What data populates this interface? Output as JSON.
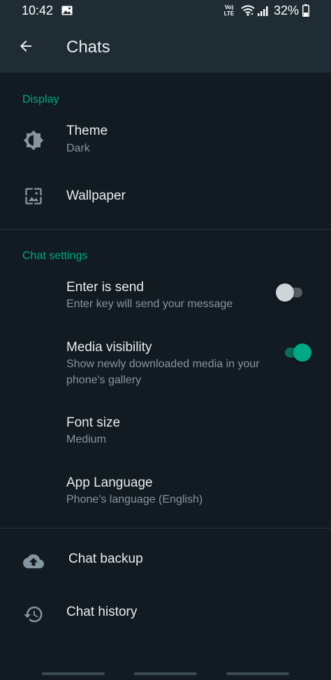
{
  "status_bar": {
    "time": "10:42",
    "network_label": "Vo) LTE",
    "battery_percent": "32%",
    "battery_level": 0.32
  },
  "app_bar": {
    "title": "Chats"
  },
  "sections": {
    "display": {
      "header": "Display",
      "theme": {
        "title": "Theme",
        "subtitle": "Dark"
      },
      "wallpaper": {
        "title": "Wallpaper"
      }
    },
    "chat_settings": {
      "header": "Chat settings",
      "enter_is_send": {
        "title": "Enter is send",
        "subtitle": "Enter key will send your message",
        "enabled": false
      },
      "media_visibility": {
        "title": "Media visibility",
        "subtitle": "Show newly downloaded media in your phone's gallery",
        "enabled": true
      },
      "font_size": {
        "title": "Font size",
        "subtitle": "Medium"
      },
      "app_language": {
        "title": "App Language",
        "subtitle": "Phone's language (English)"
      }
    },
    "other": {
      "chat_backup": {
        "title": "Chat backup"
      },
      "chat_history": {
        "title": "Chat history"
      }
    }
  },
  "colors": {
    "background": "#111b21",
    "app_bar": "#1f2c34",
    "accent": "#00a884",
    "primary_text": "#e9edef",
    "secondary_text": "#8696a0"
  },
  "icons": {
    "back": "arrow-left-icon",
    "theme": "brightness-icon",
    "wallpaper": "wallpaper-icon",
    "chat_backup": "cloud-upload-icon",
    "chat_history": "history-icon"
  }
}
